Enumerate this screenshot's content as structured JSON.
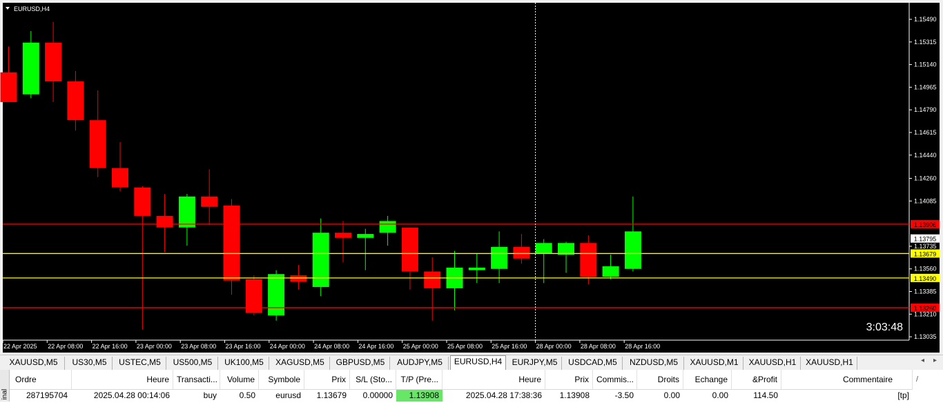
{
  "window_title": "EURUSD,H4",
  "chart_data": {
    "type": "candlestick",
    "symbol": "EURUSD",
    "timeframe": "H4",
    "price_range": [
      1.13025,
      1.1549
    ],
    "price_ticks": [
      "1.15490",
      "1.15315",
      "1.15140",
      "1.14965",
      "1.14790",
      "1.14615",
      "1.14440",
      "1.14260",
      "1.14085",
      "1.13735",
      "1.13560",
      "1.13385",
      "1.13210",
      "1.13035"
    ],
    "time_labels": [
      "22 Apr 2025",
      "22 Apr 08:00",
      "22 Apr 16:00",
      "23 Apr 00:00",
      "23 Apr 08:00",
      "23 Apr 16:00",
      "24 Apr 00:00",
      "24 Apr 08:00",
      "24 Apr 16:00",
      "25 Apr 00:00",
      "25 Apr 08:00",
      "25 Apr 16:00",
      "28 Apr 00:00",
      "28 Apr 08:00",
      "28 Apr 16:00"
    ],
    "candles": [
      {
        "o": 1.1508,
        "h": 1.1528,
        "l": 1.1493,
        "c": 1.1485
      },
      {
        "o": 1.1491,
        "h": 1.154,
        "l": 1.1488,
        "c": 1.1531
      },
      {
        "o": 1.1531,
        "h": 1.1547,
        "l": 1.1485,
        "c": 1.1501
      },
      {
        "o": 1.1501,
        "h": 1.1509,
        "l": 1.1463,
        "c": 1.1471
      },
      {
        "o": 1.1471,
        "h": 1.1494,
        "l": 1.1427,
        "c": 1.1434
      },
      {
        "o": 1.1434,
        "h": 1.1454,
        "l": 1.1416,
        "c": 1.1419
      },
      {
        "o": 1.1419,
        "h": 1.142,
        "l": 1.1309,
        "c": 1.1397
      },
      {
        "o": 1.1397,
        "h": 1.1414,
        "l": 1.1369,
        "c": 1.1388
      },
      {
        "o": 1.1388,
        "h": 1.1414,
        "l": 1.1374,
        "c": 1.1412
      },
      {
        "o": 1.1412,
        "h": 1.1433,
        "l": 1.139,
        "c": 1.1404
      },
      {
        "o": 1.1405,
        "h": 1.141,
        "l": 1.1336,
        "c": 1.1347
      },
      {
        "o": 1.1348,
        "h": 1.1351,
        "l": 1.132,
        "c": 1.1322
      },
      {
        "o": 1.132,
        "h": 1.1355,
        "l": 1.1316,
        "c": 1.1352
      },
      {
        "o": 1.1351,
        "h": 1.1359,
        "l": 1.134,
        "c": 1.1346
      },
      {
        "o": 1.1342,
        "h": 1.1395,
        "l": 1.1335,
        "c": 1.1384
      },
      {
        "o": 1.1384,
        "h": 1.1393,
        "l": 1.1361,
        "c": 1.138
      },
      {
        "o": 1.138,
        "h": 1.1387,
        "l": 1.1355,
        "c": 1.1383
      },
      {
        "o": 1.1384,
        "h": 1.1397,
        "l": 1.1374,
        "c": 1.1393
      },
      {
        "o": 1.1388,
        "h": 1.1388,
        "l": 1.134,
        "c": 1.1354
      },
      {
        "o": 1.1354,
        "h": 1.1365,
        "l": 1.1316,
        "c": 1.1341
      },
      {
        "o": 1.1341,
        "h": 1.137,
        "l": 1.1324,
        "c": 1.1357
      },
      {
        "o": 1.1355,
        "h": 1.1368,
        "l": 1.1345,
        "c": 1.1357
      },
      {
        "o": 1.1356,
        "h": 1.1385,
        "l": 1.1345,
        "c": 1.1373
      },
      {
        "o": 1.1373,
        "h": 1.1383,
        "l": 1.136,
        "c": 1.1364
      },
      {
        "o": 1.1368,
        "h": 1.1379,
        "l": 1.1345,
        "c": 1.1376
      },
      {
        "o": 1.1367,
        "h": 1.1377,
        "l": 1.1353,
        "c": 1.1376
      },
      {
        "o": 1.1376,
        "h": 1.1382,
        "l": 1.1344,
        "c": 1.135
      },
      {
        "o": 1.135,
        "h": 1.1367,
        "l": 1.1348,
        "c": 1.1358
      },
      {
        "o": 1.1356,
        "h": 1.1412,
        "l": 1.1354,
        "c": 1.1385
      }
    ],
    "levels": [
      {
        "price": 1.13906,
        "label": "1.13906",
        "color": "#ff0000",
        "style": "line"
      },
      {
        "price": 1.13679,
        "label": "1.13679",
        "color": "#ffff00",
        "style": "line"
      },
      {
        "price": 1.1349,
        "label": "1.13490",
        "color": "#ffff00",
        "style": "line"
      },
      {
        "price": 1.1326,
        "label": "1.13260",
        "color": "#ff0000",
        "style": "line"
      }
    ],
    "bid_price_label": "1.13795",
    "cursor_time": "28 Apr 00:00",
    "bull_color": "#00ff00",
    "bear_color": "#ff0000",
    "grid": false
  },
  "countdown": "3:03:48",
  "chart_tabs": [
    "XAUUSD,M5",
    "US30,M5",
    "USTEC,M5",
    "US500,M5",
    "UK100,M5",
    "XAGUSD,M5",
    "GBPUSD,M5",
    "AUDJPY,M5",
    "EURUSD,H4",
    "EURJPY,M5",
    "USDCAD,M5",
    "NZDUSD,M5",
    "XAUUSD,M1",
    "XAUUSD,H1",
    "XAUUSD,H1"
  ],
  "active_tab": "EURUSD,H4",
  "tab_nav_left": "◂",
  "tab_nav_right": "▸",
  "terminal": {
    "side_label": "inal",
    "columns": [
      "Ordre",
      "Heure",
      "Transacti...",
      "Volume",
      "Symbole",
      "Prix",
      "S/L (Sto...",
      "T/P (Pre...",
      "Heure",
      "Prix",
      "Commis...",
      "Droits",
      "Echange",
      "&Profit",
      "Commentaire"
    ],
    "sort_indicator": "/",
    "row": {
      "order": "287195704",
      "time": "2025.04.28 00:14:06",
      "type": "buy",
      "volume": "0.50",
      "symbol": "eurusd",
      "price": "1.13679",
      "sl": "0.00000",
      "tp": "1.13908",
      "close_time": "2025.04.28 17:38:36",
      "close_price": "1.13908",
      "commission": "-3.50",
      "swap": "0.00",
      "exchange": "0.00",
      "profit": "114.50",
      "comment": "[tp]"
    }
  }
}
